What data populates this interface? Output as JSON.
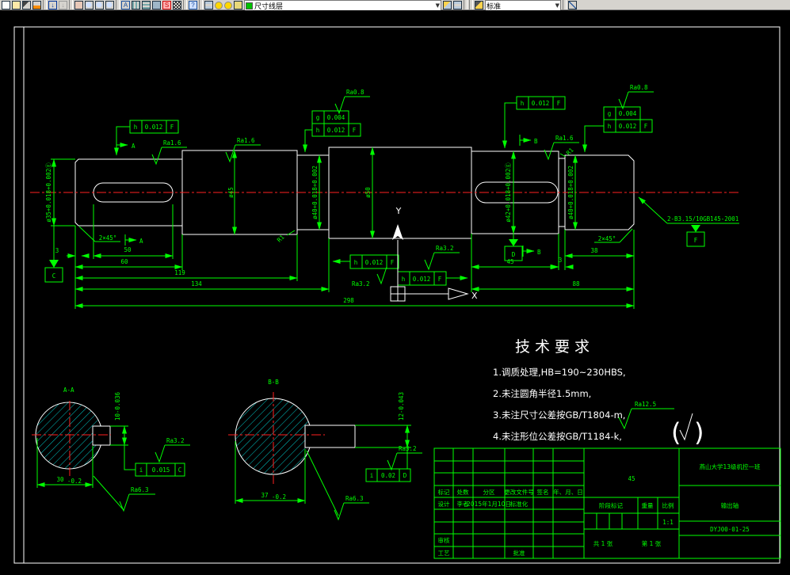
{
  "toolbar": {
    "layer_value": "尺寸线层",
    "style_value": "标准",
    "dropdown_arrow": "▼"
  },
  "dims": {
    "len_3_left": "3",
    "len_50": "50",
    "len_60": "60",
    "len_119": "119",
    "len_134": "134",
    "len_298": "298",
    "len_45": "45",
    "len_3_right": "3",
    "len_38": "38",
    "len_88": "88",
    "dia_seg1": "ø35+0.018+0.002Ⓔ",
    "dia_seg2": "ø45",
    "dia_seg3": "ø40+0.018+0.002",
    "dia_seg4": "ø50",
    "dia_seg5": "ø42+0.018+0.002Ⓔ",
    "dia_seg6": "ø40+0.018+0.002",
    "chamfer_left": "2×45°",
    "chamfer_right": "2×45°",
    "fillet": "R1"
  },
  "gdt": {
    "f1": [
      "h",
      "0.012",
      "F"
    ],
    "f2_top": [
      "g",
      "0.004"
    ],
    "f2_bot": [
      "h",
      "0.012",
      "F"
    ],
    "f3": [
      "h",
      "0.012",
      "F"
    ],
    "f4_top": [
      "g",
      "0.004"
    ],
    "f4_bot": [
      "h",
      "0.012",
      "F"
    ],
    "fb1": [
      "h",
      "0.012",
      "F"
    ],
    "fb2": [
      "h",
      "0.012",
      "F"
    ]
  },
  "surface": {
    "ra16": "Ra1.6",
    "ra08": "Ra0.8",
    "ra32": "Ra3.2",
    "ra63": "Ra6.3",
    "ra125": "Ra12.5",
    "rest_open": "(",
    "rest_close": ")"
  },
  "datums": {
    "a": "A",
    "b": "B",
    "c": "C",
    "d": "D",
    "f": "F"
  },
  "notes": {
    "center_hole": "2-B3.15/10GB145-2001"
  },
  "axes": {
    "x": "X",
    "y": "Y"
  },
  "sections": {
    "a": {
      "title": "A-A",
      "key_dim": "10-0.036",
      "depth": "30",
      "depth_tol": "-0.2",
      "frame": [
        "i",
        "0.015",
        "C"
      ]
    },
    "b": {
      "title": "B-B",
      "key_dim": "12-0.043",
      "depth": "37",
      "depth_tol": "-0.2",
      "frame": [
        "i",
        "0.02",
        "D"
      ]
    }
  },
  "tech_req": {
    "title": "技术要求",
    "items": [
      "1.调质处理,HB=190~230HBS,",
      "2.未注圆角半径1.5mm,",
      "3.未注尺寸公差按GB/T1804-m,",
      "4.未注形位公差按GB/T1184-k,"
    ]
  },
  "title_block": {
    "headers": [
      "标记",
      "处数",
      "分区",
      "更改文件号",
      "签名",
      "年、月、日"
    ],
    "design_label": "设计",
    "designer": "李者",
    "date": "2015年1月10日",
    "standard_label": "标准化",
    "check_label": "审核",
    "process_label": "工艺",
    "approve_label": "批准",
    "material": "45",
    "stage_label": "阶段标记",
    "weight_label": "重量",
    "scale_label": "比例",
    "scale_value": "1:1",
    "sheet_total": "共 1 张",
    "sheet_no": "第 1 张",
    "org": "燕山大学13级机控一班",
    "part_name": "输出轴",
    "drawing_no": "DYJ00·01-25"
  }
}
